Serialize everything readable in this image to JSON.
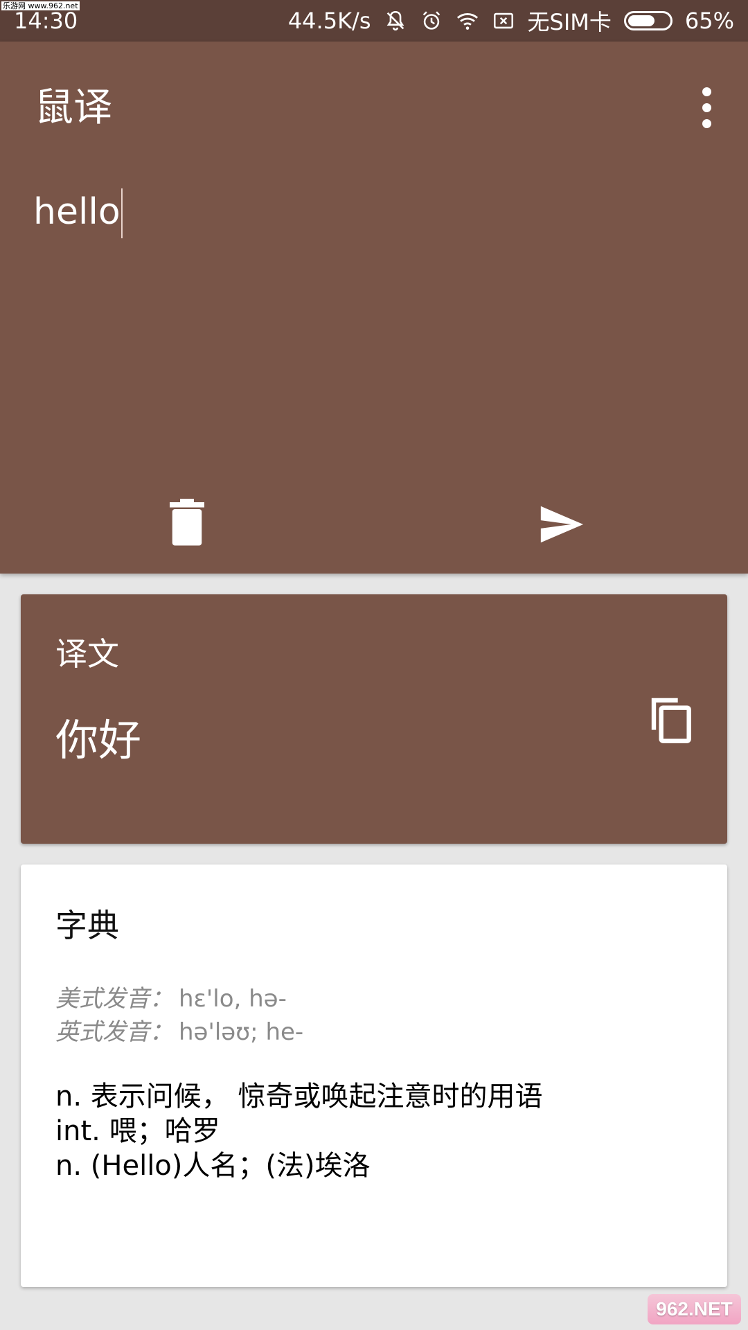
{
  "status_bar": {
    "time": "14:30",
    "net_speed": "44.5K/s",
    "sim_text": "无SIM卡",
    "battery_percent": "65%",
    "battery_level": 0.65,
    "icons": [
      "mute-icon",
      "alarm-icon",
      "wifi-icon",
      "no-sim-icon",
      "battery-icon"
    ],
    "watermark_small": "乐游网 www.962.net"
  },
  "app_bar": {
    "title": "鼠译",
    "input_value": "hello"
  },
  "actions": {
    "delete_icon": "trash-icon",
    "send_icon": "send-icon"
  },
  "translation_card": {
    "label": "译文",
    "result": "你好",
    "copy_icon": "copy-icon"
  },
  "dictionary_card": {
    "title": "字典",
    "phonetics": [
      {
        "label": "美式发音：",
        "value": "hɛ'lo, hə-"
      },
      {
        "label": "英式发音：",
        "value": "hə'ləʊ; he-"
      }
    ],
    "definitions": [
      "n. 表示问候， 惊奇或唤起注意时的用语",
      "int. 喂；哈罗",
      "n. (Hello)人名；(法)埃洛"
    ]
  },
  "watermark": {
    "text": "962.NET"
  },
  "colors": {
    "primary": "#795548",
    "status_bar": "#5b4038",
    "background": "#e6e6e6"
  }
}
